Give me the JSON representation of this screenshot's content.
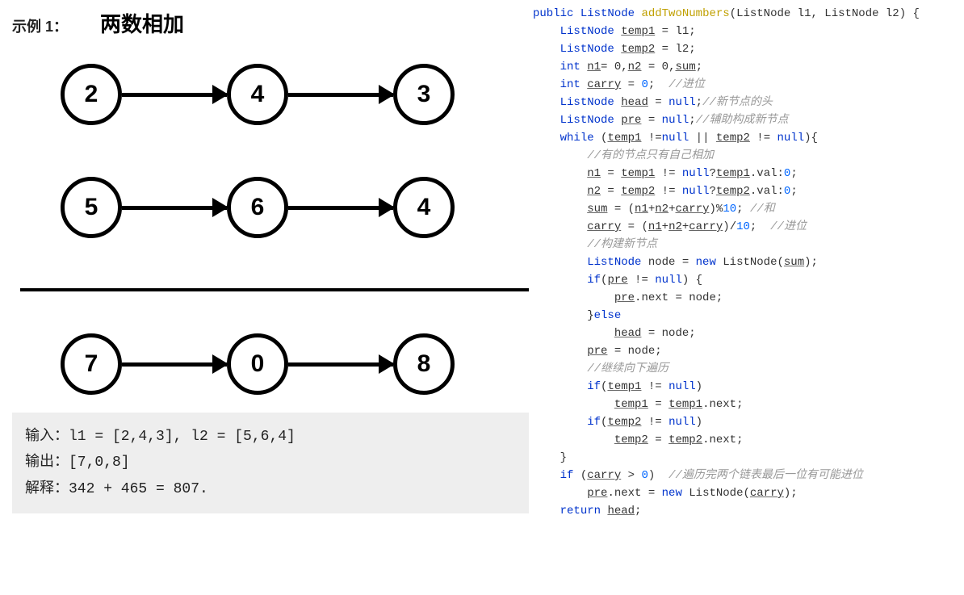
{
  "header": {
    "example_label": "示例 1：",
    "title": "两数相加"
  },
  "chains": {
    "row1": [
      "2",
      "4",
      "3"
    ],
    "row2": [
      "5",
      "6",
      "4"
    ],
    "row3": [
      "7",
      "0",
      "8"
    ]
  },
  "explanation": {
    "line1": "输入：l1 = [2,4,3], l2 = [5,6,4]",
    "line2": "输出：[7,0,8]",
    "line3": "解释：342 + 465 = 807."
  },
  "code": {
    "l01_public": "public",
    "l01_type": "ListNode",
    "l01_method": "addTwoNumbers",
    "l01_rest": "(ListNode l1, ListNode l2) {",
    "l02_ind": "    ",
    "l02_type": "ListNode",
    "l02_var": "temp1",
    "l02_rest": " = l1;",
    "l03_type": "ListNode",
    "l03_var": "temp2",
    "l03_rest": " = l2;",
    "l04_int": "int",
    "l04_n1": "n1",
    "l04_eq0": "= 0,",
    "l04_n2": "n2",
    "l04_mid": " = 0,",
    "l04_sum": "sum",
    "l04_semi": ";",
    "l05_int": "int",
    "l05_carry": "carry",
    "l05_eq": " = ",
    "l05_zero": "0",
    "l05_semi": ";  ",
    "l05_c": "//进位",
    "l06_type": "ListNode",
    "l06_head": "head",
    "l06_eq": " = ",
    "l06_null": "null",
    "l06_semi": ";",
    "l06_c": "//新节点的头",
    "l07_type": "ListNode",
    "l07_pre": "pre",
    "l07_eq": " = ",
    "l07_null": "null",
    "l07_semi": ";",
    "l07_c": "//辅助构成新节点",
    "l08_while": "while",
    "l08_open": " (",
    "l08_t1": "temp1",
    "l08_ne": " !=",
    "l08_null1": "null",
    "l08_or": " || ",
    "l08_t2": "temp2",
    "l08_ne2": " != ",
    "l08_null2": "null",
    "l08_close": "){",
    "l09_ind": "        ",
    "l09_c": "//有的节点只有自己相加",
    "l10_ind": "        ",
    "l10_n1": "n1",
    "l10_eq": " = ",
    "l10_t1": "temp1",
    "l10_ne": " != ",
    "l10_null": "null",
    "l10_q": "?",
    "l10_t1b": "temp1",
    "l10_val": ".val:",
    "l10_zero": "0",
    "l10_semi": ";",
    "l11_n2": "n2",
    "l11_eq": " = ",
    "l11_t2": "temp2",
    "l11_ne": " != ",
    "l11_null": "null",
    "l11_q": "?",
    "l11_t2b": "temp2",
    "l11_val": ".val:",
    "l11_zero": "0",
    "l11_semi": ";",
    "l12_sum": "sum",
    "l12_eq": " = (",
    "l12_n1": "n1",
    "l12_plus": "+",
    "l12_n2": "n2",
    "l12_plus2": "+",
    "l12_carry": "carry",
    "l12_mod": ")%",
    "l12_ten": "10",
    "l12_semi": "; ",
    "l12_c": "//和",
    "l13_carry": "carry",
    "l13_eq": " = (",
    "l13_n1": "n1",
    "l13_plus": "+",
    "l13_n2": "n2",
    "l13_plus2": "+",
    "l13_carry2": "carry",
    "l13_div": ")/",
    "l13_ten": "10",
    "l13_semi": ";  ",
    "l13_c": "//进位",
    "l14_c": "//构建新节点",
    "l15_type": "ListNode",
    "l15_node": " node = ",
    "l15_new": "new",
    "l15_ctor": " ListNode(",
    "l15_sum": "sum",
    "l15_close": ");",
    "l16_if": "if",
    "l16_open": "(",
    "l16_pre": "pre",
    "l16_ne": " != ",
    "l16_null": "null",
    "l16_close": ") {",
    "l17_ind": "            ",
    "l17_pre": "pre",
    "l17_next": ".next = node;",
    "l18_ind": "        }",
    "l18_else": "else",
    "l19_ind": "            ",
    "l19_head": "head",
    "l19_eq": " = node;",
    "l20_ind": "        ",
    "l20_pre": "pre",
    "l20_eq": " = node;",
    "l21_c": "//继续向下遍历",
    "l22_if": "if",
    "l22_open": "(",
    "l22_t1": "temp1",
    "l22_ne": " != ",
    "l22_null": "null",
    "l22_close": ")",
    "l23_ind": "            ",
    "l23_t1": "temp1",
    "l23_eq": " = ",
    "l23_t1b": "temp1",
    "l23_next": ".next;",
    "l24_if": "if",
    "l24_open": "(",
    "l24_t2": "temp2",
    "l24_ne": " != ",
    "l24_null": "null",
    "l24_close": ")",
    "l25_ind": "            ",
    "l25_t2": "temp2",
    "l25_eq": " = ",
    "l25_t2b": "temp2",
    "l25_next": ".next;",
    "l26": "    }",
    "l27_if": "if",
    "l27_open": " (",
    "l27_carry": "carry",
    "l27_gt": " > ",
    "l27_zero": "0",
    "l27_close": ")  ",
    "l27_c": "//遍历完两个链表最后一位有可能进位",
    "l28_ind": "        ",
    "l28_pre": "pre",
    "l28_next": ".next = ",
    "l28_new": "new",
    "l28_ctor": " ListNode(",
    "l28_carry": "carry",
    "l28_close": ");",
    "l29_ret": "return",
    "l29_head": "head",
    "l29_semi": ";"
  }
}
